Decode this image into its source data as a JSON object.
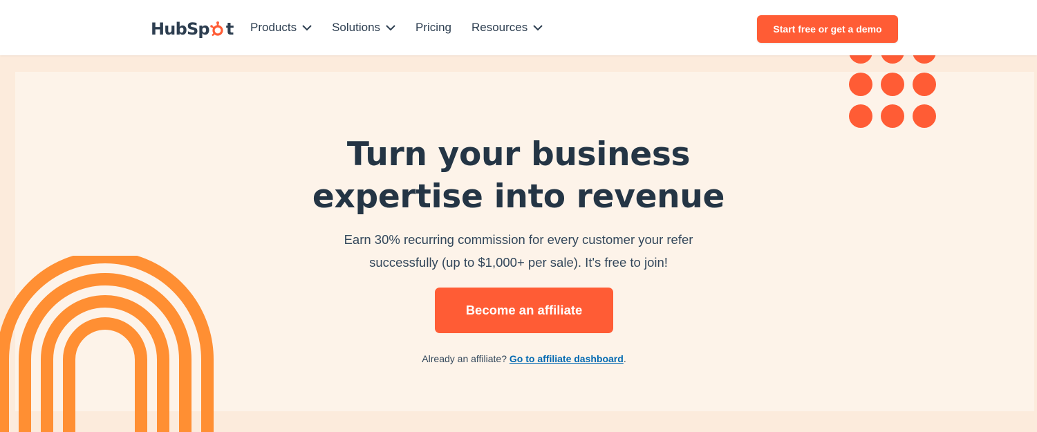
{
  "header": {
    "logo_text_before": "HubSp",
    "logo_text_after": "t",
    "nav": [
      {
        "label": "Products",
        "has_dropdown": true
      },
      {
        "label": "Solutions",
        "has_dropdown": true
      },
      {
        "label": "Pricing",
        "has_dropdown": false
      },
      {
        "label": "Resources",
        "has_dropdown": true
      }
    ],
    "cta_label": "Start free or get a demo"
  },
  "hero": {
    "title_line1": "Turn your business",
    "title_line2": "expertise into revenue",
    "subtitle_line1": "Earn 30% recurring commission for every customer your refer",
    "subtitle_line2": "successfully (up to $1,000+ per sale). It's free to join!",
    "button_label": "Become an affiliate",
    "already_prefix": "Already an affiliate? ",
    "dashboard_link": "Go to affiliate dashboard",
    "already_suffix": "."
  },
  "colors": {
    "brand_orange": "#ff5c35",
    "arch_orange": "#ff8f33",
    "heading": "#243545",
    "link": "#0068b1",
    "hero_bg": "#fdf3e9",
    "page_bg": "#fcebdc"
  },
  "icons": [
    "hubspot-sprocket-icon",
    "chevron-down-icon"
  ]
}
